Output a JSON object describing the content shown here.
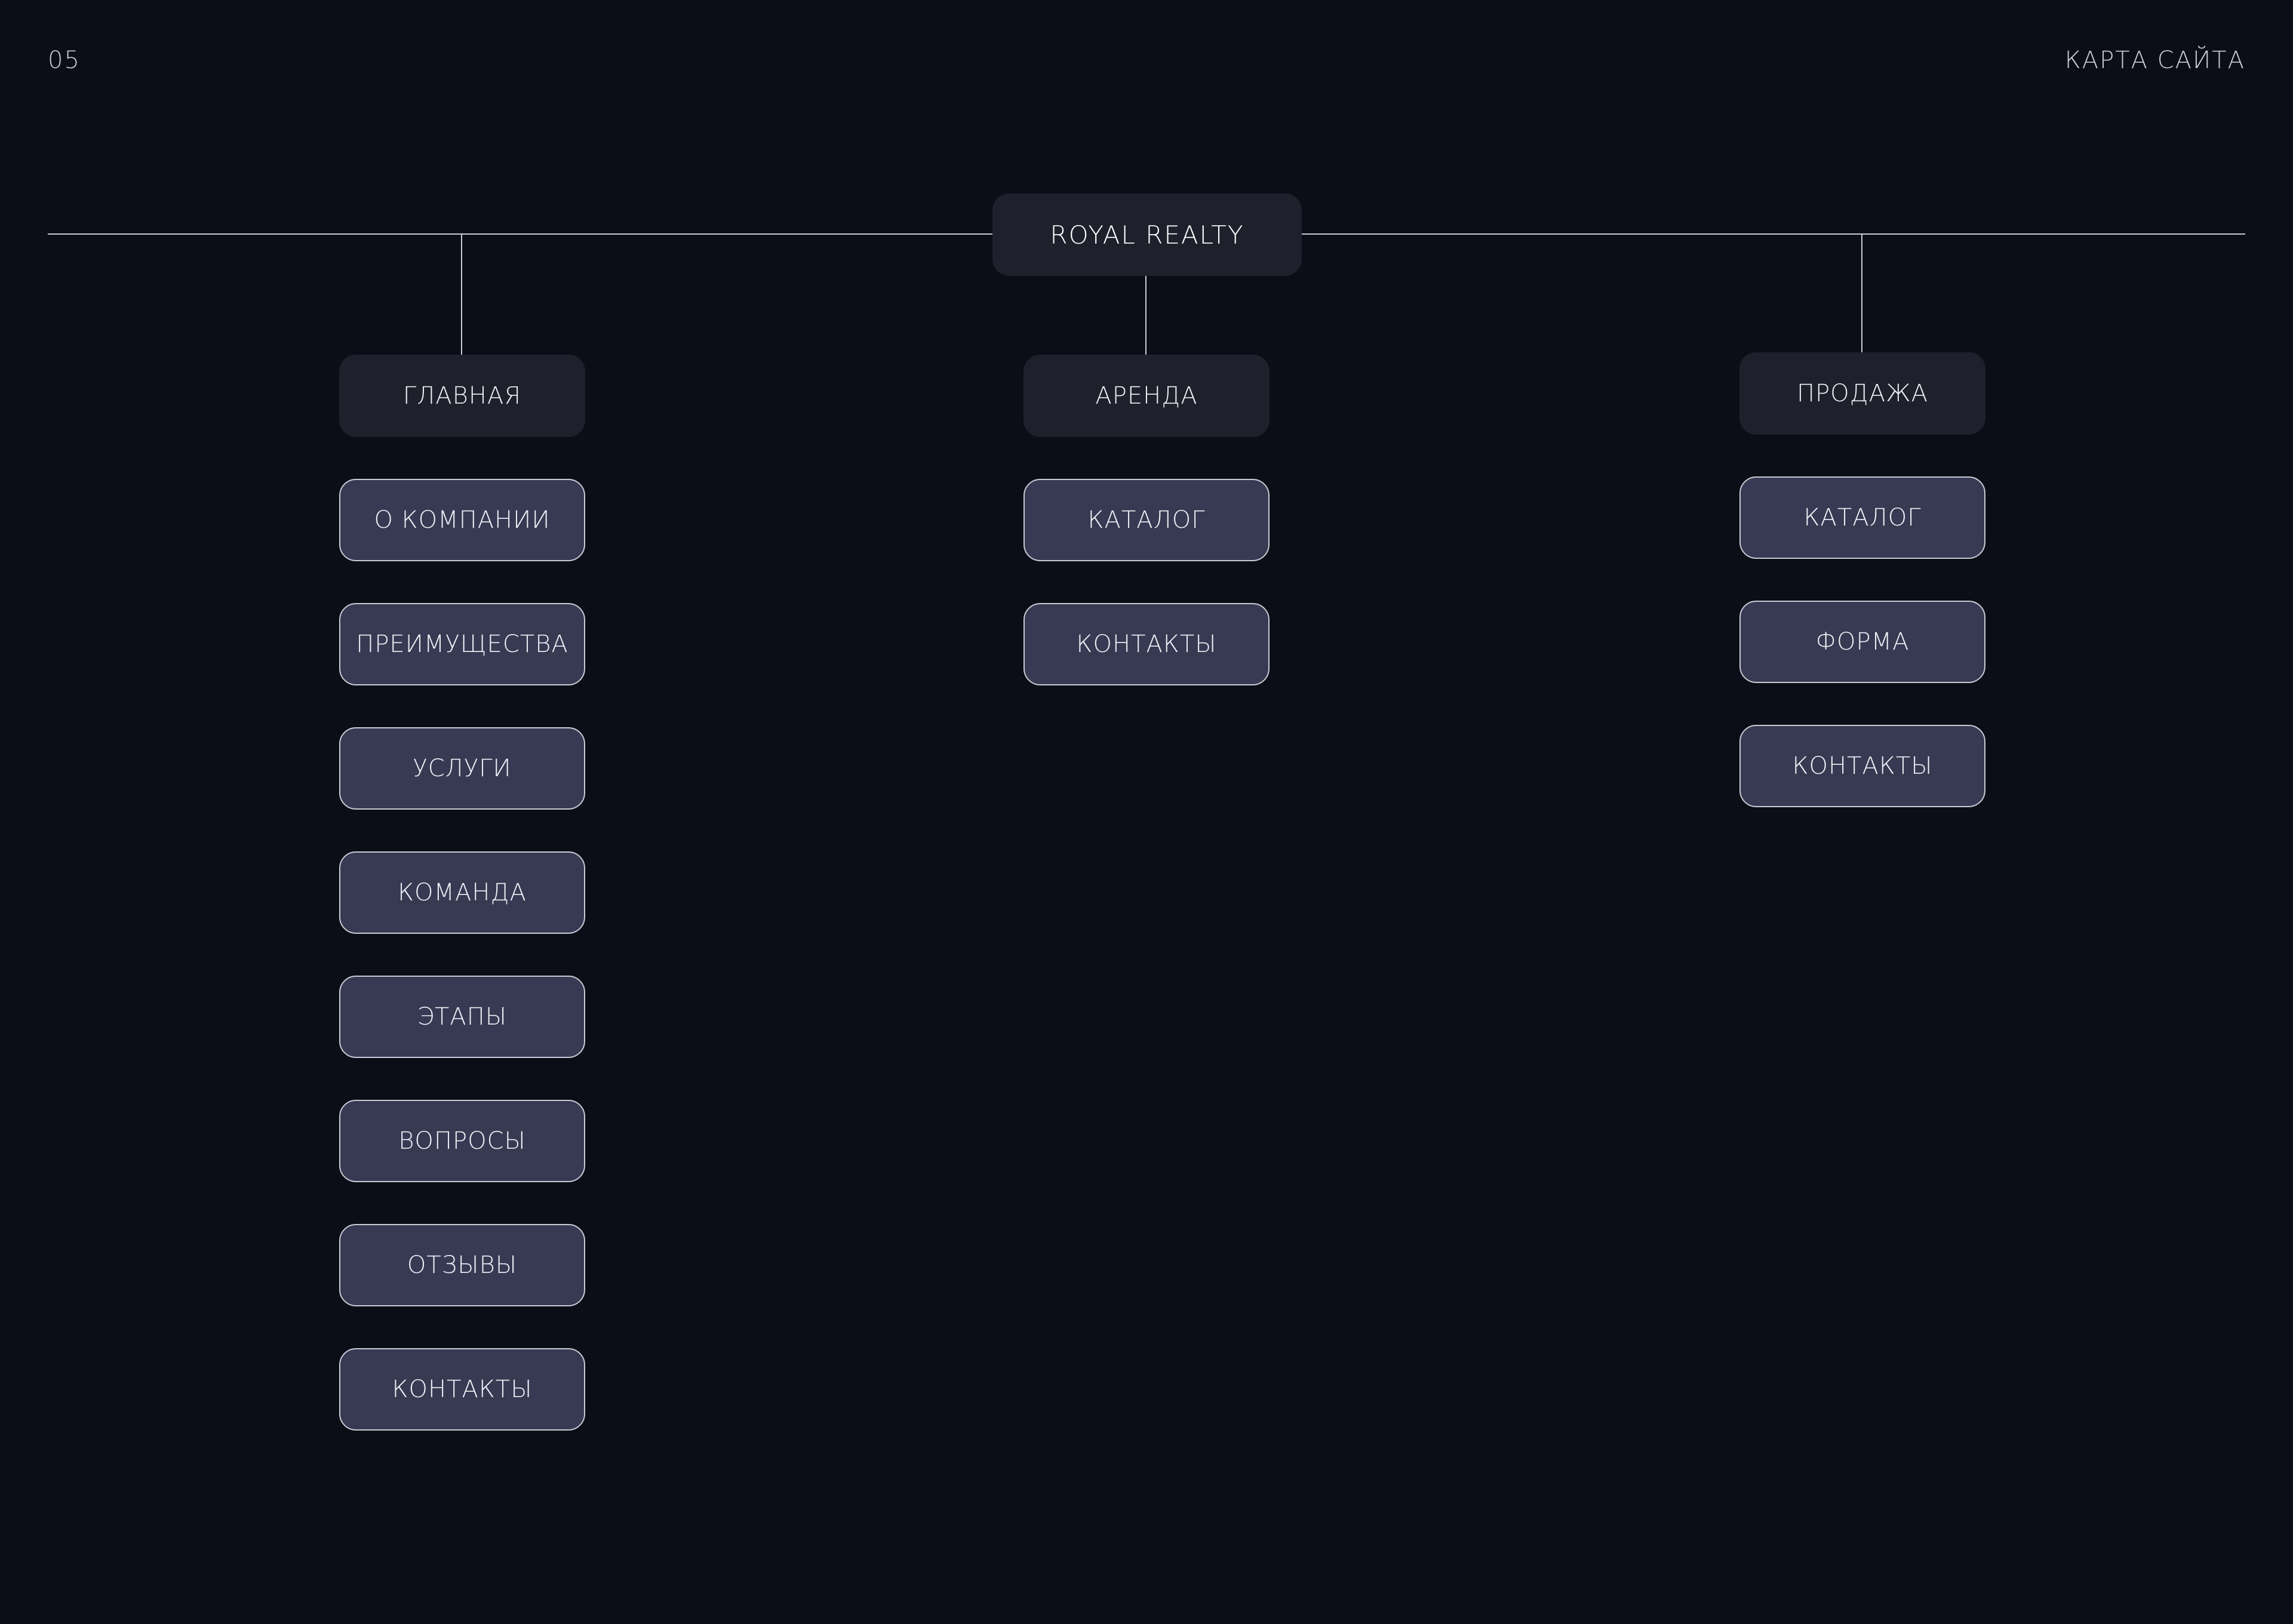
{
  "header": {
    "page_number": "05",
    "title": "КАРТА САЙТА"
  },
  "sitemap": {
    "root": "ROYAL REALTY",
    "sections": [
      {
        "label": "ГЛАВНАЯ",
        "pages": [
          "О КОМПАНИИ",
          "ПРЕИМУЩЕСТВА",
          "УСЛУГИ",
          "КОМАНДА",
          "ЭТАПЫ",
          "ВОПРОСЫ",
          "ОТЗЫВЫ",
          "КОНТАКТЫ"
        ]
      },
      {
        "label": "АРЕНДА",
        "pages": [
          "КАТАЛОГ",
          "КОНТАКТЫ"
        ]
      },
      {
        "label": "ПРОДАЖА",
        "pages": [
          "КАТАЛОГ",
          "ФОРМА",
          "КОНТАКТЫ"
        ]
      }
    ]
  },
  "colors": {
    "background": "#0b0e17",
    "section_fill": "#1e202b",
    "page_fill": "#373a52",
    "line": "#c9cbd6"
  }
}
